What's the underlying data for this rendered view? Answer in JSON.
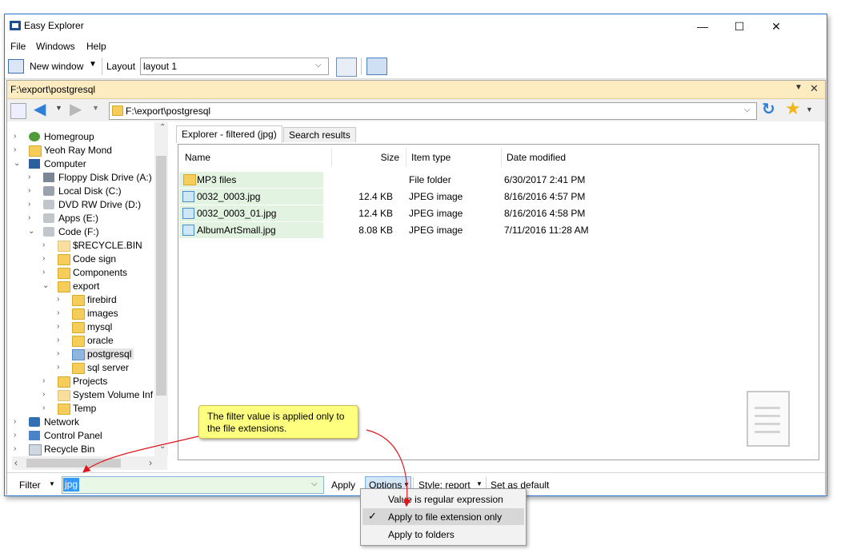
{
  "app": {
    "title": "Easy Explorer"
  },
  "window_controls": {
    "minimize": "—",
    "maximize": "☐",
    "close": "✕"
  },
  "menu": [
    "File",
    "Windows",
    "Help"
  ],
  "toolbar": {
    "new_window": "New window",
    "layout_label": "Layout",
    "layout_value": "layout 1"
  },
  "pathbar": {
    "path": "F:\\export\\postgresql"
  },
  "address": {
    "value": "F:\\export\\postgresql"
  },
  "tree": [
    {
      "label": "Homegroup"
    },
    {
      "label": "Yeoh Ray Mond"
    },
    {
      "label": "Computer"
    },
    {
      "label": "Floppy Disk Drive (A:)"
    },
    {
      "label": "Local Disk (C:)"
    },
    {
      "label": "DVD RW Drive (D:)"
    },
    {
      "label": "Apps (E:)"
    },
    {
      "label": "Code (F:)"
    },
    {
      "label": "$RECYCLE.BIN"
    },
    {
      "label": "Code sign"
    },
    {
      "label": "Components"
    },
    {
      "label": "export"
    },
    {
      "label": "firebird"
    },
    {
      "label": "images"
    },
    {
      "label": "mysql"
    },
    {
      "label": "oracle"
    },
    {
      "label": "postgresql"
    },
    {
      "label": "sql server"
    },
    {
      "label": "Projects"
    },
    {
      "label": "System Volume Inf"
    },
    {
      "label": "Temp"
    },
    {
      "label": "Network"
    },
    {
      "label": "Control Panel"
    },
    {
      "label": "Recycle Bin"
    }
  ],
  "tabs": [
    "Explorer - filtered (jpg)",
    "Search results"
  ],
  "columns": {
    "name": "Name",
    "size": "Size",
    "type": "Item type",
    "date": "Date modified"
  },
  "files": [
    {
      "name": "MP3 files",
      "size": "",
      "type": "File folder",
      "date": "6/30/2017 2:41 PM",
      "kind": "folder"
    },
    {
      "name": "0032_0003.jpg",
      "size": "12.4 KB",
      "type": "JPEG image",
      "date": "8/16/2016 4:57 PM",
      "kind": "jpg"
    },
    {
      "name": "0032_0003_01.jpg",
      "size": "12.4 KB",
      "type": "JPEG image",
      "date": "8/16/2016 4:58 PM",
      "kind": "jpg"
    },
    {
      "name": "AlbumArtSmall.jpg",
      "size": "8.08 KB",
      "type": "JPEG image",
      "date": "7/11/2016 11:28 AM",
      "kind": "jpg"
    }
  ],
  "filter": {
    "label": "Filter",
    "value": "jpg",
    "apply": "Apply",
    "options": "Options",
    "style": "Style: report",
    "set_default": "Set as default"
  },
  "options_menu": {
    "item1": "Value is regular expression",
    "item2": "Apply to file extension only",
    "item3": "Apply to folders",
    "check": "✓"
  },
  "callout": {
    "text": "The filter value is applied only to the file extensions."
  },
  "colors": {
    "accent": "#2b77d6",
    "pathbar": "#fcecc0",
    "highlight": "#e3f3e1",
    "callout": "#ffff7f",
    "arrow": "#e0161b"
  }
}
